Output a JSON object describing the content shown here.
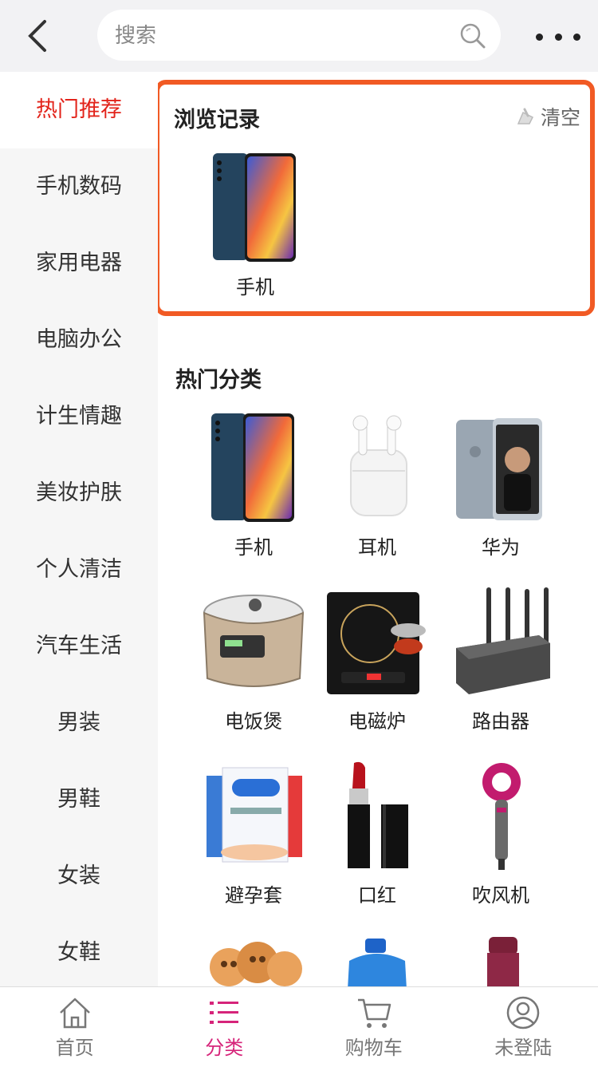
{
  "header": {
    "search_placeholder": "搜索",
    "back_icon": "chevron-left-icon",
    "search_icon": "magnifier-icon",
    "more_icon": "ellipsis-icon"
  },
  "sidebar": {
    "items": [
      {
        "label": "热门推荐",
        "active": true
      },
      {
        "label": "手机数码"
      },
      {
        "label": "家用电器"
      },
      {
        "label": "电脑办公"
      },
      {
        "label": "计生情趣"
      },
      {
        "label": "美妆护肤"
      },
      {
        "label": "个人清洁"
      },
      {
        "label": "汽车生活"
      },
      {
        "label": "男装"
      },
      {
        "label": "男鞋"
      },
      {
        "label": "女装"
      },
      {
        "label": "女鞋"
      }
    ],
    "active_color": "#e2231a"
  },
  "history": {
    "title": "浏览记录",
    "clear_label": "清空",
    "items": [
      {
        "label": "手机"
      }
    ],
    "highlight_color": "#f15a24"
  },
  "hot": {
    "title": "热门分类",
    "items": [
      {
        "label": "手机"
      },
      {
        "label": "耳机"
      },
      {
        "label": "华为"
      },
      {
        "label": "电饭煲"
      },
      {
        "label": "电磁炉"
      },
      {
        "label": "路由器"
      },
      {
        "label": "避孕套"
      },
      {
        "label": "口红"
      },
      {
        "label": "吹风机"
      }
    ]
  },
  "tabbar": {
    "tabs": [
      {
        "label": "首页",
        "icon": "home-icon"
      },
      {
        "label": "分类",
        "icon": "category-list-icon",
        "active": true
      },
      {
        "label": "购物车",
        "icon": "cart-icon"
      },
      {
        "label": "未登陆",
        "icon": "user-icon"
      }
    ],
    "active_color": "#d6247a"
  }
}
